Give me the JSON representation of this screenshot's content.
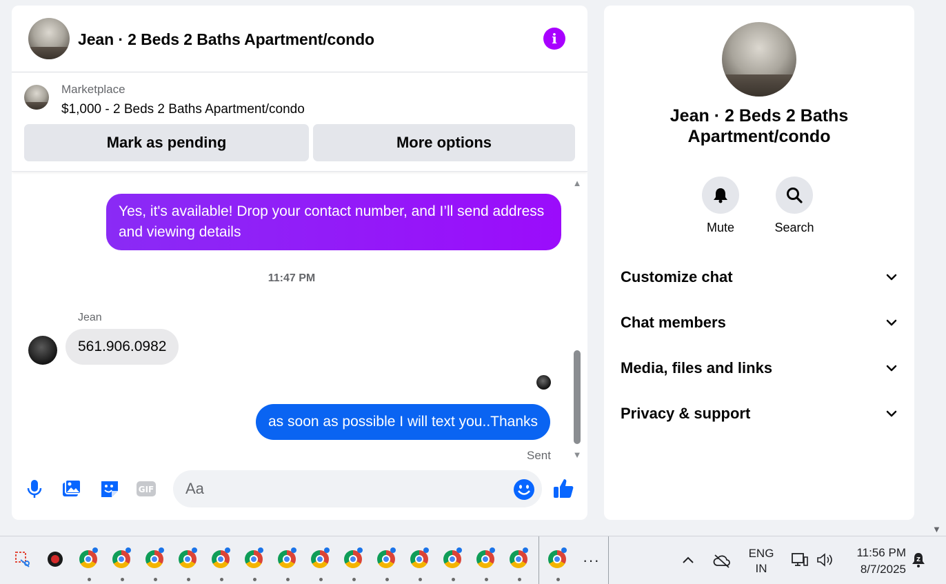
{
  "chat": {
    "header_title": "Jean · 2 Beds 2 Baths Apartment/condo",
    "listing": {
      "source": "Marketplace",
      "price_title": "$1,000 - 2 Beds 2 Baths Apartment/condo",
      "mark_pending_label": "Mark as pending",
      "more_options_label": "More options"
    },
    "messages": [
      {
        "from": "me",
        "text": "Yes, it's available! Drop your contact number, and I’ll send address and viewing details"
      },
      {
        "timestamp": "11:47 PM"
      },
      {
        "from": "Jean",
        "text": "561.906.0982"
      },
      {
        "from": "me",
        "text": "as soon as possible I will text you..Thanks",
        "status": "Sent"
      }
    ],
    "composer": {
      "placeholder": "Aa"
    }
  },
  "info_panel": {
    "title": "Jean · 2 Beds 2 Baths Apartment/condo",
    "actions": [
      {
        "label": "Mute",
        "icon": "bell-icon"
      },
      {
        "label": "Search",
        "icon": "search-icon"
      }
    ],
    "sections": [
      "Customize chat",
      "Chat members",
      "Media, files and links",
      "Privacy & support"
    ]
  },
  "taskbar": {
    "language_line1": "ENG",
    "language_line2": "IN",
    "time": "11:56 PM",
    "date": "8/7/2025"
  },
  "colors": {
    "accent_purple": "#a800ff",
    "sent_bubble_blue": "#0a64f2",
    "received_bubble": "#e9e9eb",
    "messenger_blue": "#0866ff"
  }
}
